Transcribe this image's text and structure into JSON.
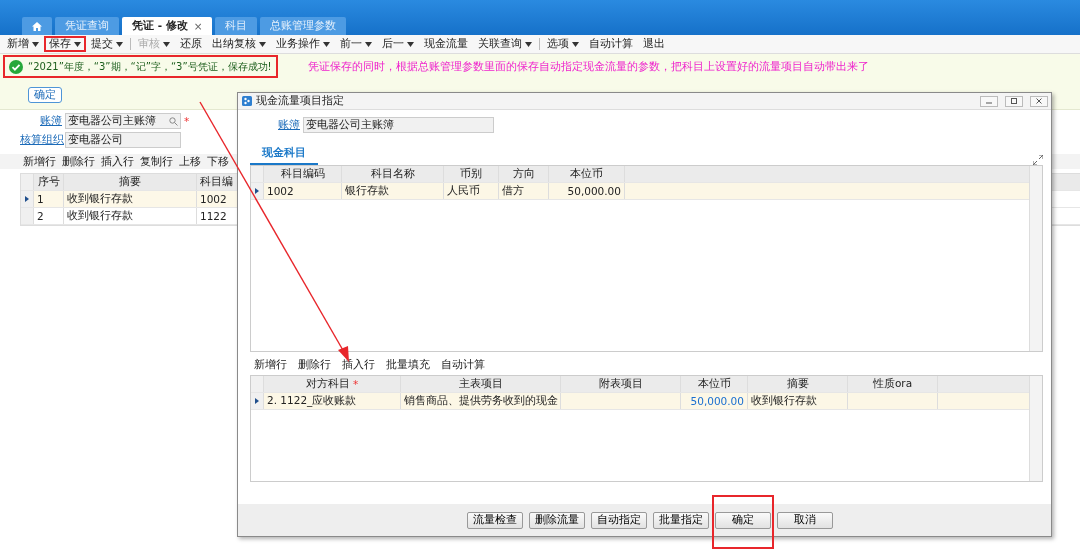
{
  "tabs": [
    {
      "kind": "home",
      "selected": false
    },
    {
      "kind": "text",
      "label": "凭证查询",
      "selected": false
    },
    {
      "kind": "text",
      "label": "凭证 - 修改",
      "selected": true,
      "close": "×"
    },
    {
      "kind": "text",
      "label": "科目",
      "selected": false
    },
    {
      "kind": "text",
      "label": "总账管理参数",
      "selected": false
    }
  ],
  "toolbar": [
    {
      "label": "新增",
      "dropdown": true,
      "disabled": false,
      "highlighted": false
    },
    {
      "label": "保存",
      "dropdown": true,
      "disabled": false,
      "highlighted": true
    },
    {
      "label": "提交",
      "dropdown": true,
      "disabled": false,
      "highlighted": false,
      "separator_after": true
    },
    {
      "label": "审核",
      "dropdown": true,
      "disabled": true,
      "highlighted": false
    },
    {
      "label": "还原",
      "dropdown": false,
      "disabled": false,
      "highlighted": false
    },
    {
      "label": "出纳复核",
      "dropdown": true,
      "disabled": false,
      "highlighted": false
    },
    {
      "label": "业务操作",
      "dropdown": true,
      "disabled": false,
      "highlighted": false
    },
    {
      "label": "前一",
      "dropdown": true,
      "disabled": false,
      "highlighted": false
    },
    {
      "label": "后一",
      "dropdown": true,
      "disabled": false,
      "highlighted": false
    },
    {
      "label": "现金流量",
      "dropdown": false,
      "disabled": false,
      "highlighted": false
    },
    {
      "label": "关联查询",
      "dropdown": true,
      "disabled": false,
      "highlighted": false,
      "separator_after": true
    },
    {
      "label": "选项",
      "dropdown": true,
      "disabled": false,
      "highlighted": false
    },
    {
      "label": "自动计算",
      "dropdown": false,
      "disabled": false,
      "highlighted": false
    },
    {
      "label": "退出",
      "dropdown": false,
      "disabled": false,
      "highlighted": false
    }
  ],
  "message": {
    "text": "“2021”年度，“3”期，“记”字，“3”号凭证，保存成功!",
    "ok_button": "确定",
    "annotation": "凭证保存的同时，根据总账管理参数里面的保存自动指定现金流量的参数，把科目上设置好的流量项目自动带出来了"
  },
  "form": {
    "fields": [
      {
        "label": "账簿",
        "value": "变电器公司主账簿",
        "required": "*",
        "search": true
      },
      {
        "label": "核算组织",
        "value": "变电器公司",
        "search": false
      }
    ]
  },
  "grid_toolbar": [
    "新增行",
    "删除行",
    "插入行",
    "复制行",
    "上移",
    "下移"
  ],
  "grid": {
    "columns": [
      "序号",
      "摘要",
      "科目编"
    ],
    "rows": [
      {
        "selected": true,
        "cells": [
          "1",
          "收到银行存款",
          "1002"
        ]
      },
      {
        "selected": false,
        "cells": [
          "2",
          "收到银行存款",
          "1122"
        ]
      }
    ]
  },
  "dialog": {
    "title": "现金流量项目指定",
    "field": {
      "label": "账簿",
      "value": "变电器公司主账簿"
    },
    "tabs": [
      {
        "label": "现金科目",
        "selected": true
      }
    ],
    "upper_grid": {
      "columns": [
        "科目编码",
        "科目名称",
        "币别",
        "方向",
        "本位币"
      ],
      "rows": [
        {
          "selected": true,
          "cells": [
            "1002",
            "银行存款",
            "人民币",
            "借方",
            "50,000.00"
          ]
        }
      ]
    },
    "lower_toolbar": [
      "新增行",
      "删除行",
      "插入行",
      "批量填充",
      "自动计算"
    ],
    "lower_grid": {
      "columns": [
        {
          "label": "对方科目",
          "required": "*"
        },
        {
          "label": "主表项目"
        },
        {
          "label": "附表项目"
        },
        {
          "label": "本位币"
        },
        {
          "label": "摘要"
        },
        {
          "label": "性质ora"
        }
      ],
      "rows": [
        {
          "selected": true,
          "cells": [
            "2. 1122_应收账款",
            "销售商品、提供劳务收到的现金",
            "",
            "50,000.00",
            "收到银行存款",
            ""
          ]
        }
      ]
    },
    "buttons": [
      {
        "label": "流量检查",
        "highlighted": false
      },
      {
        "label": "删除流量",
        "highlighted": false
      },
      {
        "label": "自动指定",
        "highlighted": false
      },
      {
        "label": "批量指定",
        "highlighted": false
      },
      {
        "label": "确定",
        "highlighted": true
      },
      {
        "label": "取消",
        "highlighted": false
      }
    ]
  }
}
